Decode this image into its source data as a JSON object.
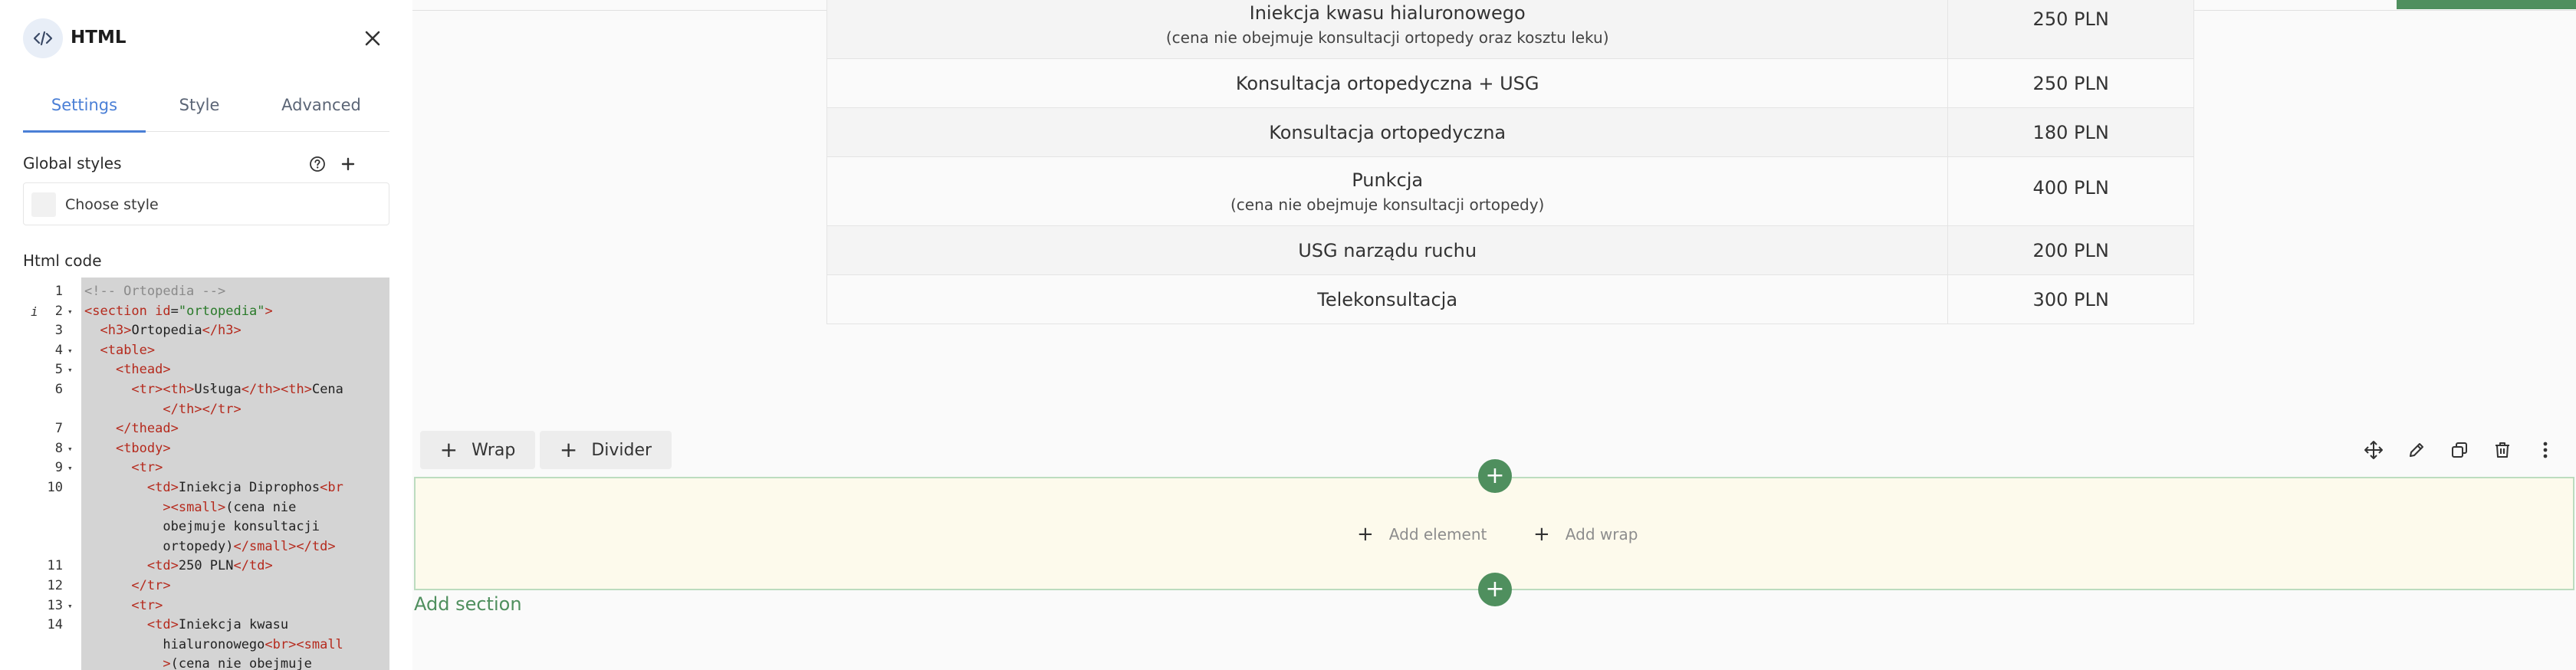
{
  "panel": {
    "title": "HTML",
    "tabs": [
      "Settings",
      "Style",
      "Advanced"
    ],
    "global_styles_label": "Global styles",
    "style_select_placeholder": "Choose style",
    "html_code_label": "Html code"
  },
  "editor": {
    "lines": [
      {
        "n": "1",
        "code": "<!-- Ortopedia -->"
      },
      {
        "n": "2",
        "code": "<section id=\"ortopedia\">"
      },
      {
        "n": "3",
        "code": "  <h3>Ortopedia</h3>"
      },
      {
        "n": "4",
        "code": "  <table>"
      },
      {
        "n": "5",
        "code": "    <thead>"
      },
      {
        "n": "6",
        "code": "      <tr><th>Usługa</th><th>Cena"
      },
      {
        "n": "",
        "code": "          </th></tr>"
      },
      {
        "n": "7",
        "code": "    </thead>"
      },
      {
        "n": "8",
        "code": "    <tbody>"
      },
      {
        "n": "9",
        "code": "      <tr>"
      },
      {
        "n": "10",
        "code": "        <td>Iniekcja Diprophos<br"
      },
      {
        "n": "",
        "code": "          ><small>(cena nie"
      },
      {
        "n": "",
        "code": "          obejmuje konsultacji"
      },
      {
        "n": "",
        "code": "          ortopedy)</small></td>"
      },
      {
        "n": "11",
        "code": "        <td>250 PLN</td>"
      },
      {
        "n": "12",
        "code": "      </tr>"
      },
      {
        "n": "13",
        "code": "      <tr>"
      },
      {
        "n": "14",
        "code": "        <td>Iniekcja kwasu"
      },
      {
        "n": "",
        "code": "          hialuronowego<br><small"
      },
      {
        "n": "",
        "code": "          >(cena nie obejmuje"
      }
    ]
  },
  "table": {
    "rows": [
      {
        "service": "Iniekcja kwasu hialuronowego",
        "note": "(cena nie obejmuje konsultacji ortopedy oraz kosztu leku)",
        "price": "250 PLN"
      },
      {
        "service": "Konsultacja ortopedyczna + USG",
        "note": "",
        "price": "250 PLN"
      },
      {
        "service": "Konsultacja ortopedyczna",
        "note": "",
        "price": "180 PLN"
      },
      {
        "service": "Punkcja",
        "note": "(cena nie obejmuje konsultacji ortopedy)",
        "price": "400 PLN"
      },
      {
        "service": "USG narządu ruchu",
        "note": "",
        "price": "200 PLN"
      },
      {
        "service": "Telekonsultacja",
        "note": "",
        "price": "300 PLN"
      }
    ]
  },
  "toolbar": {
    "wrap_label": "Wrap",
    "divider_label": "Divider"
  },
  "empty_wrap": {
    "add_element_label": "Add element",
    "add_wrap_label": "Add wrap"
  },
  "add_section_label": "Add section",
  "colors": {
    "accent_blue": "#4a7fd6",
    "accent_green": "#4f8f5e",
    "wrap_bg": "#fdfaec"
  }
}
